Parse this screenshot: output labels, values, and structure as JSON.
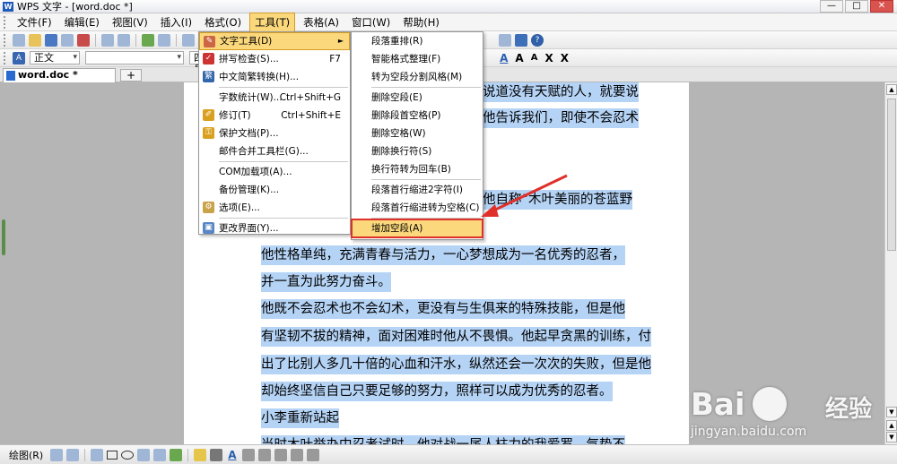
{
  "window": {
    "title": "WPS 文字 - [word.doc *]",
    "app_icon_letter": "W"
  },
  "menubar": [
    "文件(F)",
    "编辑(E)",
    "视图(V)",
    "插入(I)",
    "格式(O)",
    "工具(T)",
    "表格(A)",
    "窗口(W)",
    "帮助(H)"
  ],
  "toolbar2": {
    "style": "正文",
    "font": "",
    "size": "四号"
  },
  "tab": {
    "label": "word.doc *",
    "new_tab": "+"
  },
  "tools_menu": [
    {
      "label": "文字工具(D)",
      "shortcut": "",
      "icon": "text-tools-icon"
    },
    {
      "label": "拼写检查(S)...",
      "shortcut": "F7",
      "icon": "spell-check-icon"
    },
    {
      "label": "中文简繁转换(H)...",
      "shortcut": "",
      "icon": "convert-icon"
    },
    {
      "label": "字数统计(W)...",
      "shortcut": "Ctrl+Shift+G",
      "icon": ""
    },
    {
      "label": "修订(T)",
      "shortcut": "Ctrl+Shift+E",
      "icon": "revision-icon"
    },
    {
      "label": "保护文档(P)...",
      "shortcut": "",
      "icon": "protect-icon"
    },
    {
      "label": "邮件合并工具栏(G)...",
      "shortcut": "",
      "icon": ""
    },
    {
      "label": "COM加载项(A)...",
      "shortcut": "",
      "icon": ""
    },
    {
      "label": "备份管理(K)...",
      "shortcut": "",
      "icon": ""
    },
    {
      "label": "选项(E)...",
      "shortcut": "",
      "icon": "gear-icon"
    },
    {
      "label": "更改界面(Y)...",
      "shortcut": "",
      "icon": "interface-icon"
    }
  ],
  "text_tools_submenu": [
    "段落重排(R)",
    "智能格式整理(F)",
    "转为空段分割风格(M)",
    "删除空段(E)",
    "删除段首空格(P)",
    "删除空格(W)",
    "删除换行符(S)",
    "换行符转为回车(B)",
    "段落首行缩进2字符(I)",
    "段落首行缩进转为空格(C)",
    "增加空段(A)"
  ],
  "document_lines": [
    "说道没有天赋的人，就要说",
    "他告诉我们，即使不会忍术",
    "他自称“木叶美丽的苍蓝野",
    "他性格单纯，充满青春与活力，一心梦想成为一名优秀的忍者，",
    "并一直为此努力奋斗。",
    "他既不会忍术也不会幻术，更没有与生俱来的特殊技能，但是他",
    "有坚韧不拔的精神，面对困难时他从不畏惧。他起早贪黑的训练，付",
    "出了比别人多几十倍的心血和汗水，纵然还会一次次的失败，但是他",
    "却始终坚信自己只要足够的努力，照样可以成为优秀的忍者。",
    "小李重新站起",
    "当时木叶举办中忍考试时，他对战一尾人柱力的我爱罗，气势不"
  ],
  "drawbar": {
    "label": "绘图(R)"
  },
  "watermark": {
    "brand_left": "Bai",
    "brand_right": "经验",
    "url": "jingyan.baidu.com"
  },
  "colors": {
    "selection": "#b5d3f5",
    "highlight": "#fbd87c",
    "annotation": "#e0302a"
  }
}
